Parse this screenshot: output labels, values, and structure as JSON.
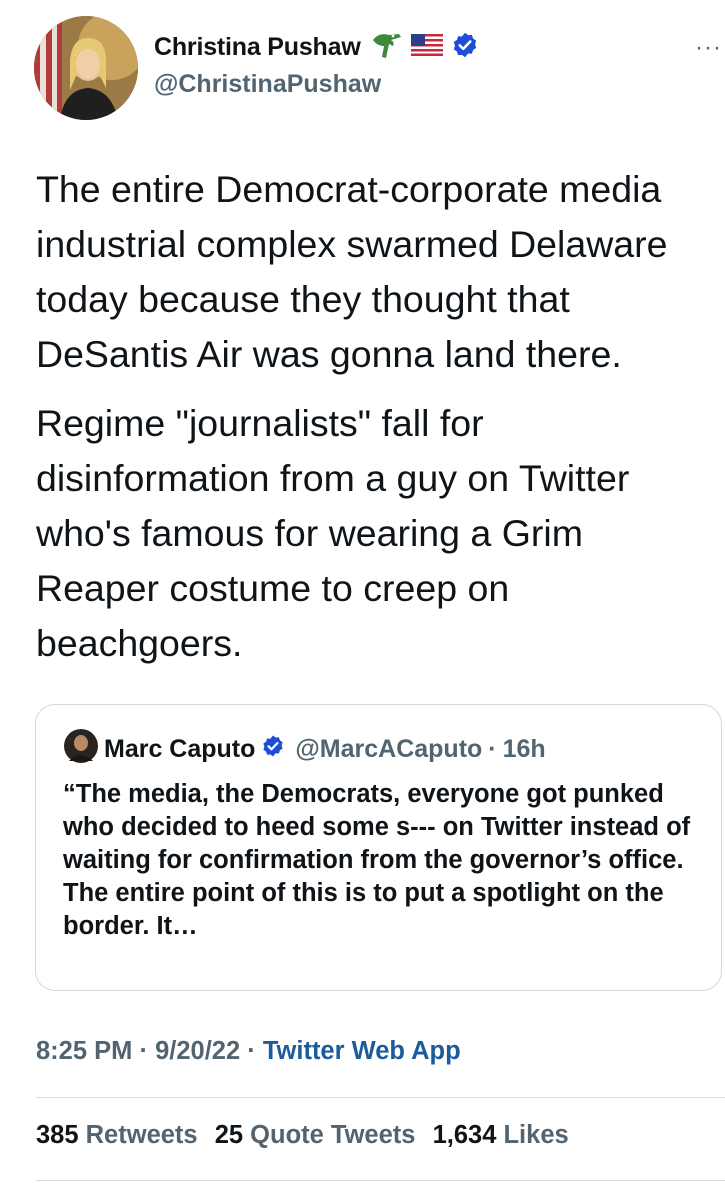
{
  "author": {
    "display_name": "Christina Pushaw",
    "handle": "@ChristinaPushaw",
    "name_emojis": [
      "alligator-icon",
      "us-flag-icon"
    ],
    "verified": true
  },
  "more_label": "···",
  "tweet": {
    "paragraphs": [
      "The entire Democrat-corporate media industrial complex swarmed Delaware today because they thought that DeSantis Air was gonna land there.",
      "Regime \"journalists\" fall for disinformation from a guy on Twitter who's famous for wearing a Grim Reaper costume to creep on beachgoers."
    ]
  },
  "quote": {
    "display_name": "Marc Caputo",
    "handle": "@MarcACaputo",
    "separator": "·",
    "time": "16h",
    "text": "“The media, the Democrats, everyone got punked who decided to heed some s--- on Twitter instead of waiting for confirmation from the governor’s office. The entire point of this is to put a spotlight on the border. It…"
  },
  "meta": {
    "time": "8:25 PM",
    "separator": "·",
    "date": "9/20/22",
    "app": "Twitter Web App"
  },
  "stats": {
    "retweets": "385",
    "retweets_label": "Retweets",
    "quotes": "25",
    "quotes_label": "Quote Tweets",
    "likes": "1,634",
    "likes_label": "Likes"
  },
  "colors": {
    "verified": "#1d9bf0",
    "secondary_text": "#536471",
    "link": "#1d5c9c"
  }
}
